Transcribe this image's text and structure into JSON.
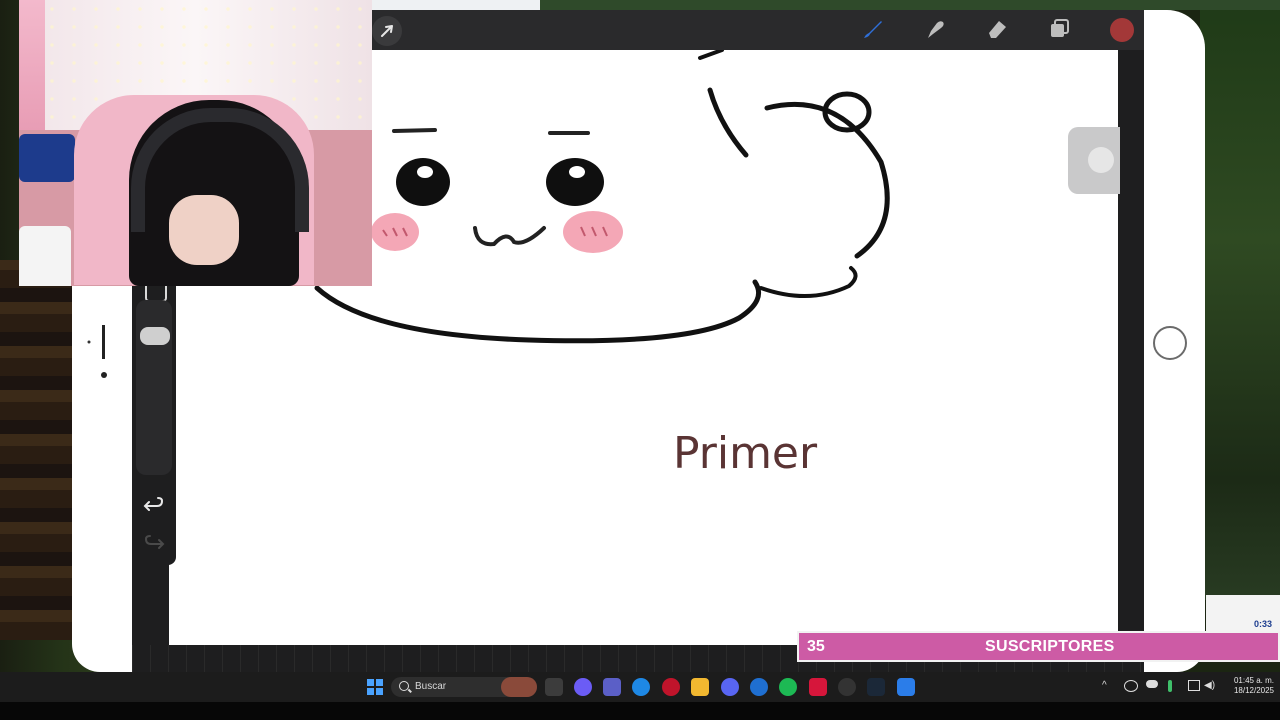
{
  "canvas": {
    "handwritten_text": "Primer"
  },
  "stream_overlay": {
    "subscriber_count": "35",
    "subscriber_label": "SUSCRIPTORES",
    "timer": "0:33"
  },
  "taskbar": {
    "search_placeholder": "Buscar",
    "time": "01:45 a. m.",
    "date": "18/12/2025"
  },
  "colors": {
    "brush_active": "#2f6fd8",
    "selected_color": "#a33838",
    "overlay_bar": "#cd5ba5"
  },
  "icons": [
    "brush-icon",
    "smudge-icon",
    "eraser-icon",
    "layers-icon",
    "cursor-icon",
    "undo-icon",
    "redo-icon",
    "windows-start-icon",
    "search-icon"
  ]
}
